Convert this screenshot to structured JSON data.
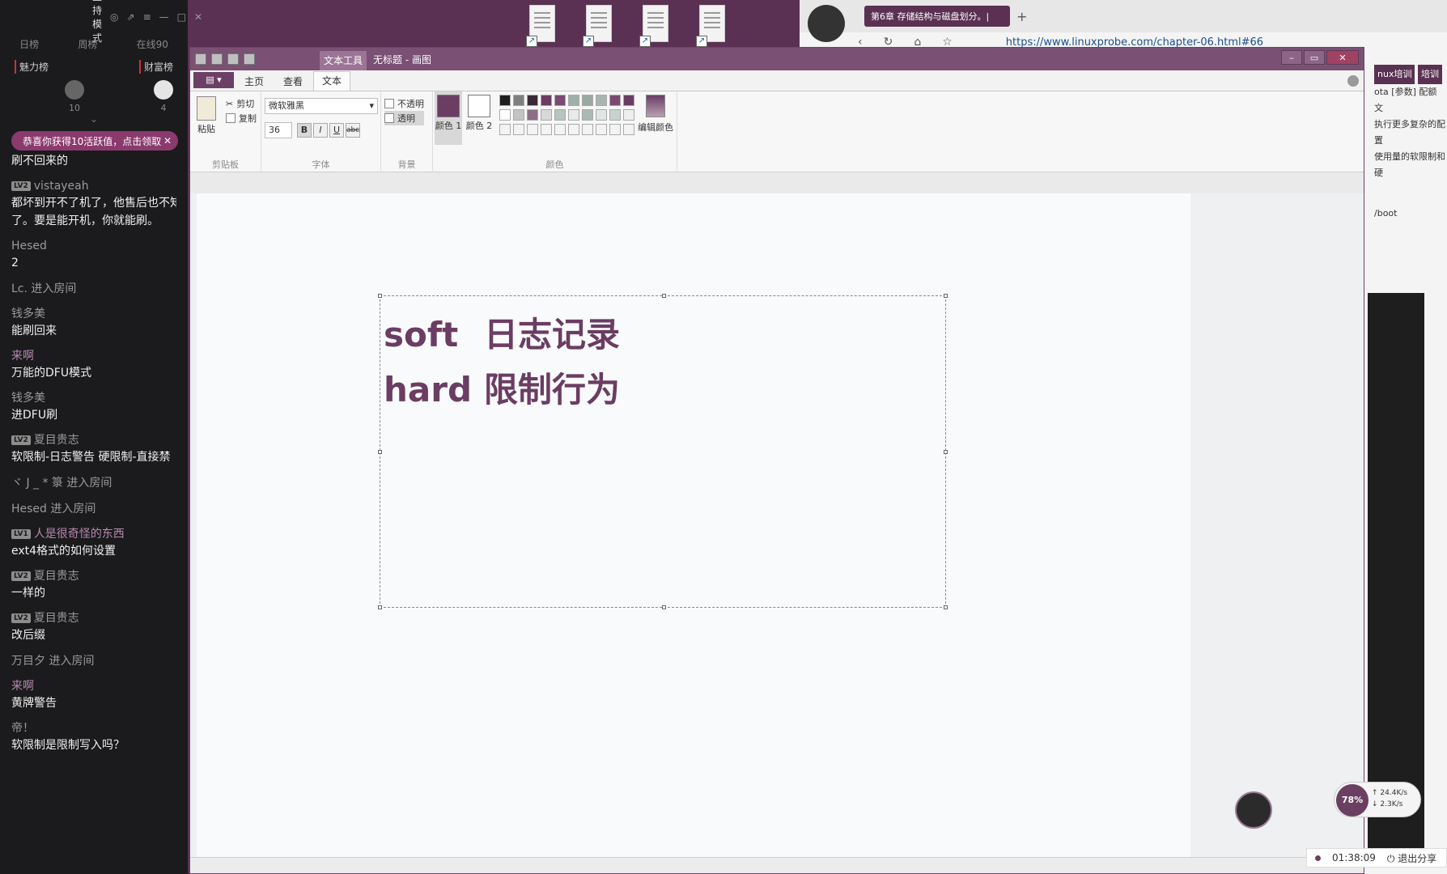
{
  "stream": {
    "mode_label": "主持模式",
    "tabs": [
      "日榜",
      "周榜",
      "在线90"
    ],
    "rank_left": "魅力榜",
    "rank_right": "财富榜",
    "rank_counts": [
      "10",
      "4"
    ],
    "notice": "恭喜你获得10活跃值，点击领取",
    "chat": [
      {
        "user": "",
        "lv": "",
        "text": "刷不回来的",
        "enter": ""
      },
      {
        "user": "vistayeah",
        "lv": "LV2",
        "text": "都坏到开不了机了，他售后也不知",
        "text2": "了。要是能开机，你就能刷。"
      },
      {
        "user": "Hesed",
        "lv": "",
        "text": "2"
      },
      {
        "user": "",
        "lv": "",
        "text": "",
        "enter": "Lc. 进入房间"
      },
      {
        "user": "钱多美",
        "lv": "",
        "text": "能刷回来"
      },
      {
        "user": "来啊",
        "lv": "",
        "text": "万能的DFU模式",
        "pink": true
      },
      {
        "user": "钱多美",
        "lv": "",
        "text": "进DFU刷"
      },
      {
        "user": "夏目贵志",
        "lv": "LV2",
        "text": "软限制-日志警告 硬限制-直接禁"
      },
      {
        "user": "",
        "lv": "",
        "text": "",
        "enter": "ヾ J _ * 箓 进入房间"
      },
      {
        "user": "",
        "lv": "",
        "text": "",
        "enter": "Hesed 进入房间"
      },
      {
        "user": "人是很奇怪的东西",
        "lv": "LV1",
        "text": "ext4格式的如何设置",
        "pink": true
      },
      {
        "user": "夏目贵志",
        "lv": "LV2",
        "text": "一样的"
      },
      {
        "user": "夏目贵志",
        "lv": "LV2",
        "text": "改后缀"
      },
      {
        "user": "",
        "lv": "",
        "text": "",
        "enter": "万目夕 进入房间"
      },
      {
        "user": "来啊",
        "lv": "",
        "text": "黄牌警告",
        "pink": true
      },
      {
        "user": "帝！",
        "lv": "",
        "text": "软限制是限制写入吗？"
      }
    ]
  },
  "browser": {
    "tab_title": "第6章 存储结构与磁盘划分。|",
    "url": "https://www.linuxprobe.com/chapter-06.html#66",
    "side_nav": "nux培训",
    "side_nav2": "培训",
    "side_lines": [
      "ota [参数] 配额 文",
      "执行更多复杂的配置",
      "使用量的软限制和硬",
      "/boot"
    ]
  },
  "paint": {
    "ctx_tab": "文本工具",
    "title": "无标题 - 画图",
    "file_tab": "▤ ▾",
    "tabs": [
      "主页",
      "查看",
      "文本"
    ],
    "clipboard": {
      "paste": "粘贴",
      "cut": "剪切",
      "copy": "复制",
      "label": "剪贴板"
    },
    "font": {
      "name": "微软雅黑",
      "size": "36",
      "label": "字体",
      "bold": "B",
      "italic": "I",
      "underline": "U",
      "strike": "abc"
    },
    "background": {
      "opaque": "不透明",
      "transparent": "透明",
      "label": "背景"
    },
    "colors": {
      "color1": "颜色 1",
      "color2": "颜色 2",
      "edit": "编辑颜色",
      "label": "颜色",
      "color1_hex": "#6b3d63",
      "color2_hex": "#ffffff"
    },
    "canvas_lines": [
      {
        "left": "soft",
        "right": "日志记录"
      },
      {
        "left": "hard",
        "right": "限制行为"
      }
    ]
  },
  "overlay": {
    "percent": "78%",
    "up": "↑ 24.4K/s",
    "down": "↓ 2.3K/s",
    "timer": "01:38:09",
    "exit_share": "退出分享"
  }
}
